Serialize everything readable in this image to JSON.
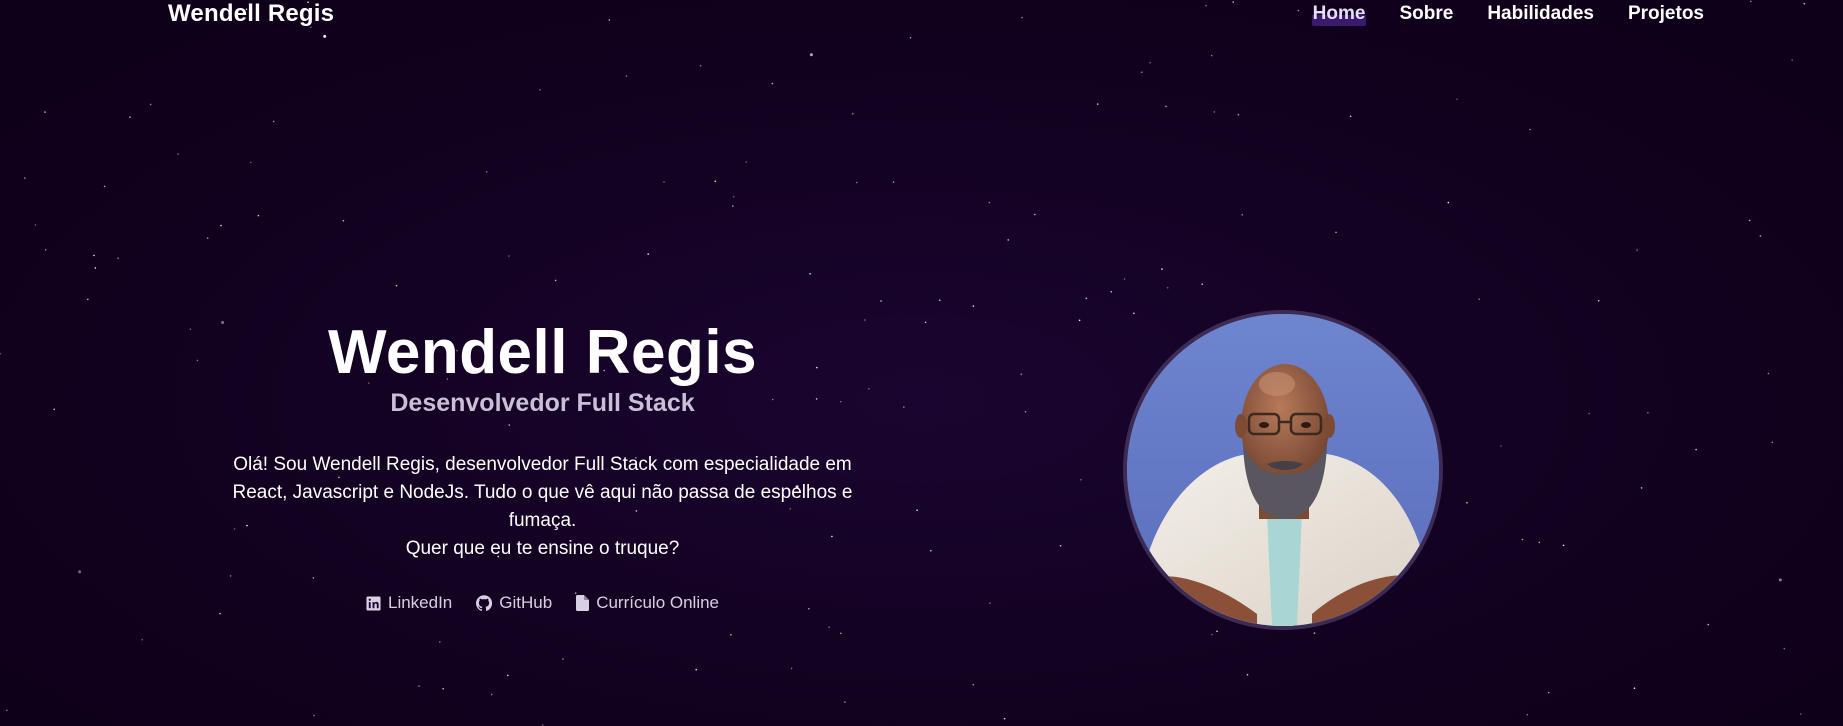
{
  "header": {
    "brand": "Wendell Regis",
    "nav": [
      {
        "label": "Home",
        "active": true
      },
      {
        "label": "Sobre",
        "active": false
      },
      {
        "label": "Habilidades",
        "active": false
      },
      {
        "label": "Projetos",
        "active": false
      }
    ]
  },
  "hero": {
    "name": "Wendell Regis",
    "role": "Desenvolvedor Full Stack",
    "description_1": "Olá! Sou Wendell Regis, desenvolvedor Full Stack com especialidade em React, Javascript e NodeJs. Tudo o que vê aqui não passa de espelhos e fumaça.",
    "description_2": "Quer que eu te ensine o truque?",
    "links": [
      {
        "label": "LinkedIn",
        "icon": "linkedin-icon"
      },
      {
        "label": "GitHub",
        "icon": "github-icon"
      },
      {
        "label": "Currículo Online",
        "icon": "document-icon"
      }
    ]
  },
  "colors": {
    "background": "#11001f",
    "accent": "#3a1a6e",
    "text": "#ffffff",
    "muted_text": "#c9bfd6"
  }
}
